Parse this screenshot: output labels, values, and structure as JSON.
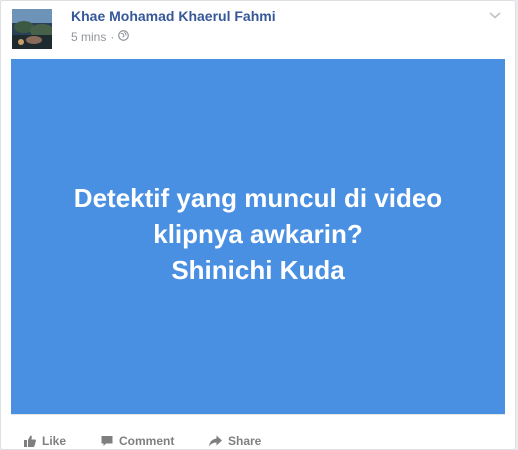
{
  "post": {
    "author": "Khae Mohamad Khaerul Fahmi",
    "timestamp": "5 mins",
    "separator": "·",
    "privacy_icon": "globe-icon",
    "menu_icon": "chevron-down-icon",
    "text_lines": [
      "Detektif yang muncul di video",
      "klipnya awkarin?",
      "Shinichi Kuda"
    ],
    "banner_color": "#4a90e2"
  },
  "actions": {
    "like_label": "Like",
    "comment_label": "Comment",
    "share_label": "Share"
  }
}
